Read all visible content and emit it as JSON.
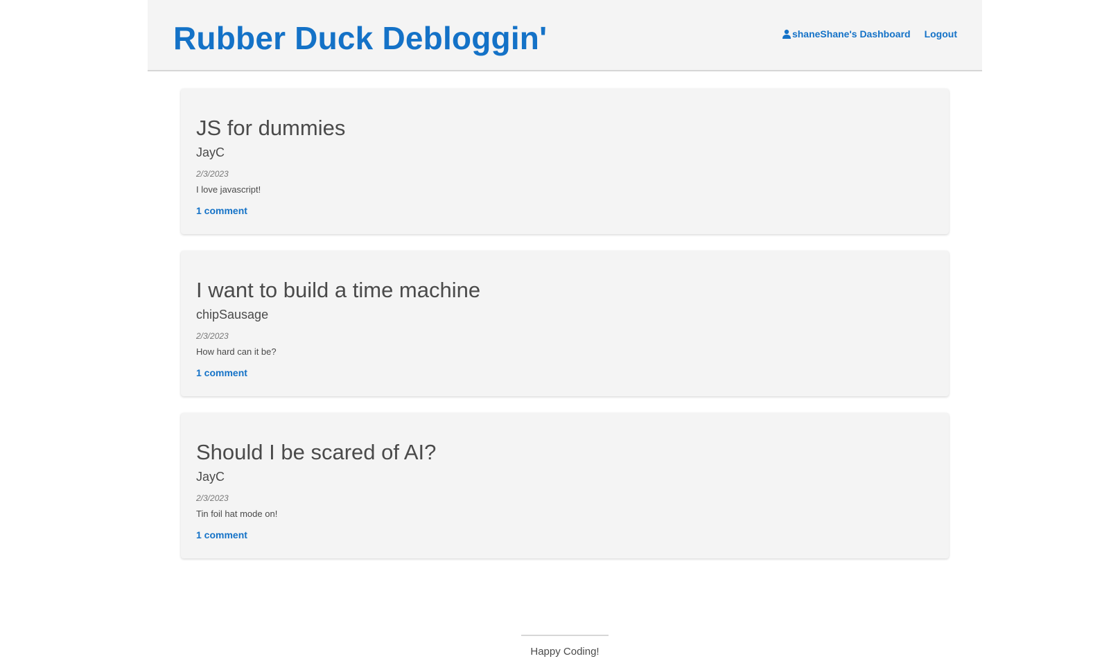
{
  "header": {
    "site_title": "Rubber Duck Debloggin'",
    "nav": {
      "dashboard_label": "shaneShane's Dashboard",
      "dashboard_icon": "user-icon",
      "logout_label": "Logout"
    }
  },
  "posts": [
    {
      "title": "JS for dummies",
      "author": "JayC",
      "date": "2/3/2023",
      "body": "I love javascript!",
      "comments": "1 comment"
    },
    {
      "title": "I want to build a time machine",
      "author": "chipSausage",
      "date": "2/3/2023",
      "body": "How hard can it be?",
      "comments": "1 comment"
    },
    {
      "title": "Should I be scared of AI?",
      "author": "JayC",
      "date": "2/3/2023",
      "body": "Tin foil hat mode on!",
      "comments": "1 comment"
    }
  ],
  "footer": {
    "text": "Happy Coding!"
  },
  "colors": {
    "accent": "#1472c7",
    "card_background": "#f4f4f4",
    "text": "#4a4a4a"
  }
}
